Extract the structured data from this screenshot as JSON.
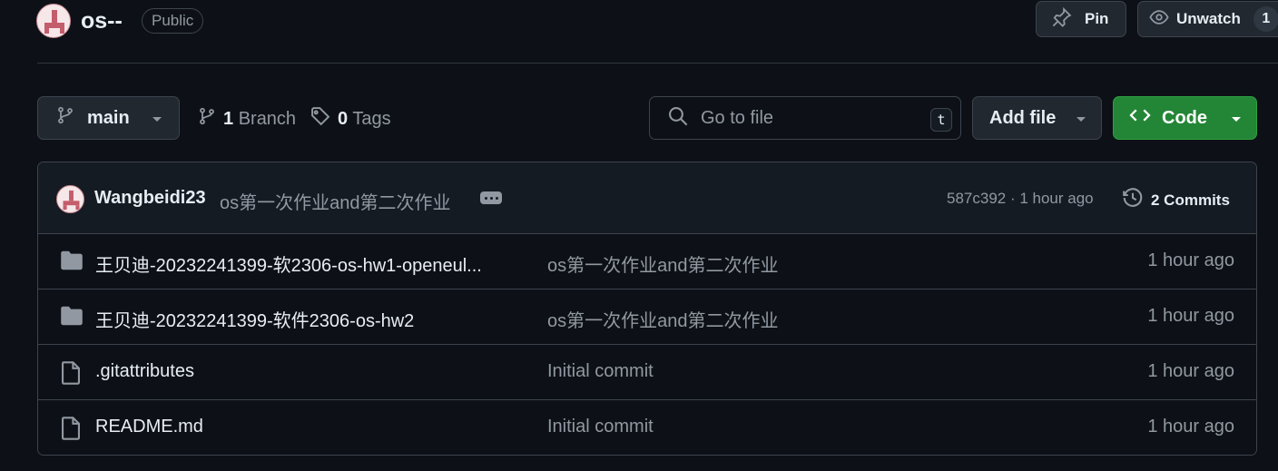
{
  "repo": {
    "name": "os--",
    "visibility": "Public"
  },
  "header_buttons": {
    "pin_label": "Pin",
    "unwatch_label": "Unwatch",
    "watch_count": "1"
  },
  "toolbar": {
    "branch_name": "main",
    "branch_count": "1",
    "branch_label": "Branch",
    "tag_count": "0",
    "tag_label": "Tags",
    "search_placeholder": "Go to file",
    "search_shortcut": "t",
    "add_file_label": "Add file",
    "code_label": "Code"
  },
  "latest_commit": {
    "author": "Wangbeidi23",
    "message": "os第一次作业and第二次作业",
    "sha_and_time": "587c392 · 1 hour ago",
    "commits_count_label": "2 Commits"
  },
  "files": [
    {
      "type": "folder",
      "name": "王贝迪-20232241399-软2306-os-hw1-openeul...",
      "commit_message": "os第一次作业and第二次作业",
      "time": "1 hour ago"
    },
    {
      "type": "folder",
      "name": "王贝迪-20232241399-软件2306-os-hw2",
      "commit_message": "os第一次作业and第二次作业",
      "time": "1 hour ago"
    },
    {
      "type": "file",
      "name": ".gitattributes",
      "commit_message": "Initial commit",
      "time": "1 hour ago"
    },
    {
      "type": "file",
      "name": "README.md",
      "commit_message": "Initial commit",
      "time": "1 hour ago"
    }
  ],
  "icons": {
    "avatar": "identicon-avatar",
    "pin": "pin-icon",
    "eye": "eye-icon",
    "branch": "git-branch-icon",
    "tag": "tag-icon",
    "search": "search-icon",
    "code": "code-icon",
    "history": "history-icon",
    "folder": "folder-icon",
    "file": "file-icon"
  },
  "colors": {
    "background": "#0d1117",
    "code_button": "#238636",
    "text_primary": "#e6edf3",
    "text_muted": "#9198a1",
    "border": "#3d444d"
  }
}
